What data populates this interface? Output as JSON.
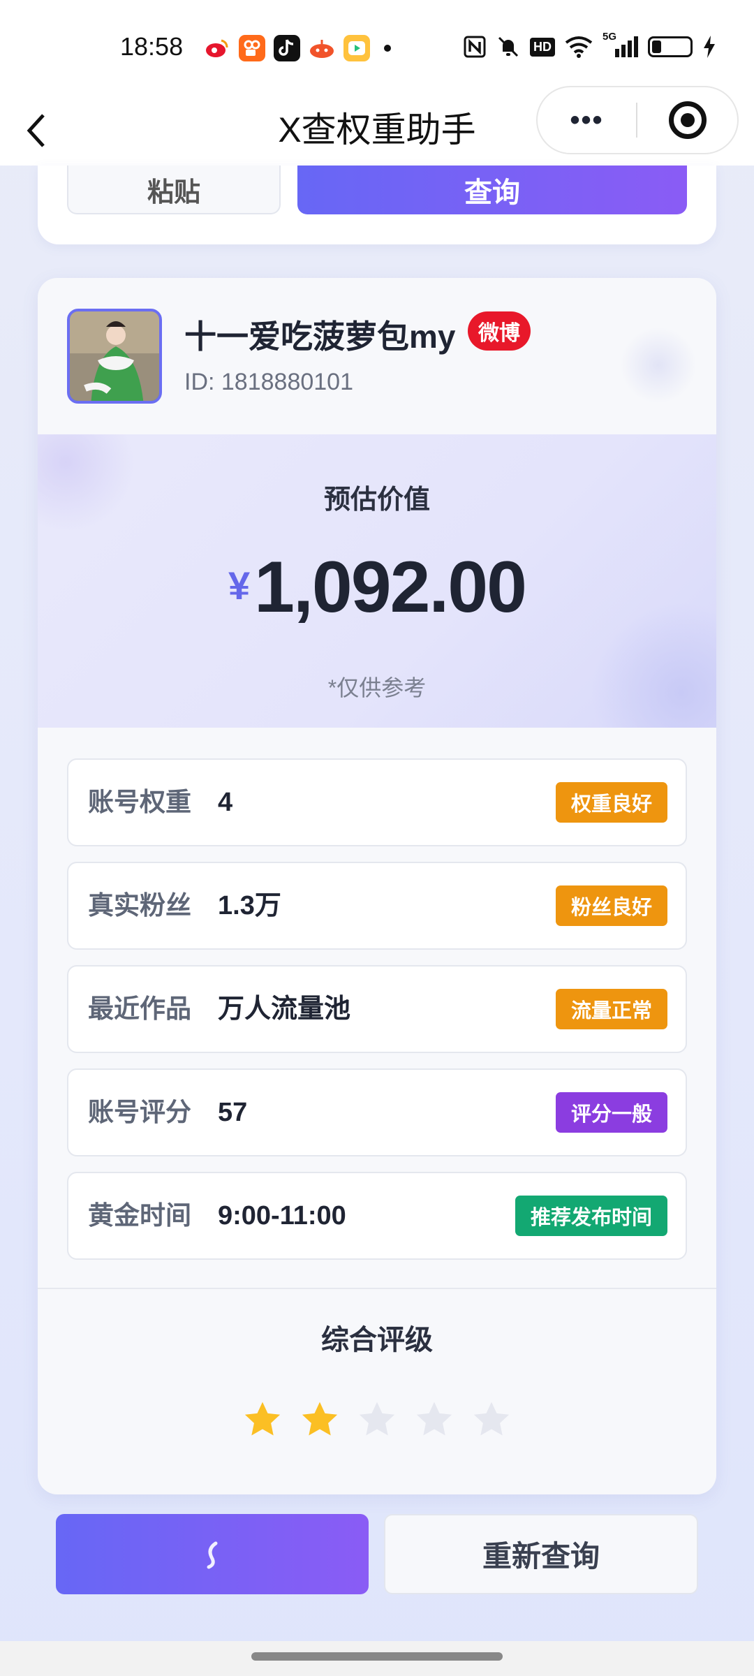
{
  "status_bar": {
    "time": "18:58",
    "app_icons": [
      "weibo-icon",
      "kuaishou-icon",
      "douyin-icon",
      "taobao-icon",
      "video-icon"
    ],
    "indicators": [
      "nfc-icon",
      "mute-icon",
      "hd-icon",
      "wifi-icon",
      "signal-5g-icon"
    ],
    "network": "5G",
    "hd": "HD",
    "battery_level": 0.25
  },
  "nav": {
    "title": "X查权重助手",
    "more": "•••"
  },
  "top_card": {
    "paste_label": "粘贴",
    "query_label": "查询"
  },
  "profile": {
    "name": "十一爱吃菠萝包my",
    "platform": "微博",
    "id_text": "ID: 1818880101"
  },
  "valuation": {
    "label": "预估价值",
    "currency": "¥",
    "amount": "1,092.00",
    "note": "*仅供参考"
  },
  "metrics": [
    {
      "label": "账号权重",
      "value": "4",
      "tag": "权重良好",
      "tag_color": "#ee950f"
    },
    {
      "label": "真实粉丝",
      "value": "1.3万",
      "tag": "粉丝良好",
      "tag_color": "#ee950f"
    },
    {
      "label": "最近作品",
      "value": "万人流量池",
      "tag": "流量正常",
      "tag_color": "#ee950f"
    },
    {
      "label": "账号评分",
      "value": "57",
      "tag": "评分一般",
      "tag_color": "#8b3de0"
    },
    {
      "label": "黄金时间",
      "value": "9:00-11:00",
      "tag": "推荐发布时间",
      "tag_color": "#13a872"
    }
  ],
  "rating": {
    "title": "综合评级",
    "stars_filled": 2,
    "stars_total": 5,
    "star_color": "#fbbf24",
    "star_empty_color": "#e5e7ef"
  },
  "bottom": {
    "requery_label": "重新查询",
    "share_icon": "share-icon"
  },
  "colors": {
    "accent": "#6767f5",
    "accent2": "#8a5cf5",
    "weibo_red": "#e8182a"
  }
}
